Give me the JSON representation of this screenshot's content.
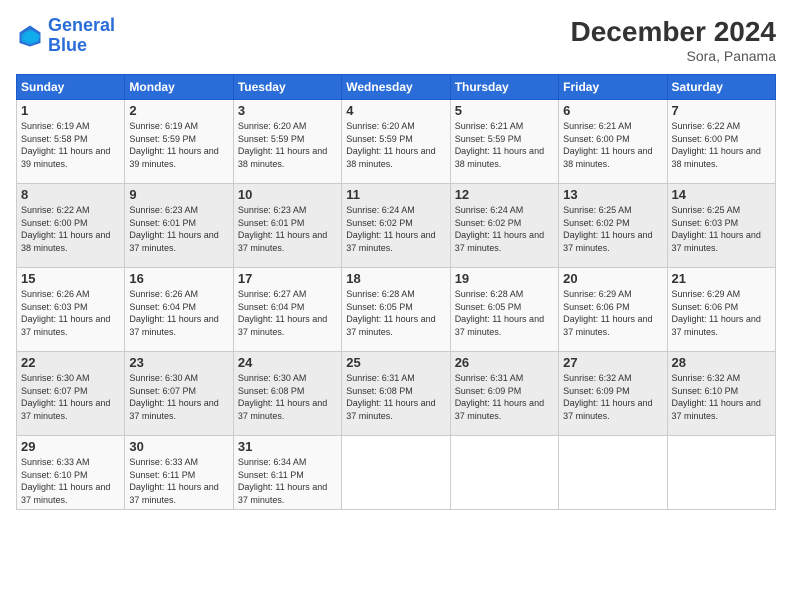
{
  "header": {
    "logo_line1": "General",
    "logo_line2": "Blue",
    "month": "December 2024",
    "location": "Sora, Panama"
  },
  "days_of_week": [
    "Sunday",
    "Monday",
    "Tuesday",
    "Wednesday",
    "Thursday",
    "Friday",
    "Saturday"
  ],
  "weeks": [
    [
      {
        "day": "1",
        "sunrise": "6:19 AM",
        "sunset": "5:58 PM",
        "daylight": "11 hours and 39 minutes."
      },
      {
        "day": "2",
        "sunrise": "6:19 AM",
        "sunset": "5:59 PM",
        "daylight": "11 hours and 39 minutes."
      },
      {
        "day": "3",
        "sunrise": "6:20 AM",
        "sunset": "5:59 PM",
        "daylight": "11 hours and 38 minutes."
      },
      {
        "day": "4",
        "sunrise": "6:20 AM",
        "sunset": "5:59 PM",
        "daylight": "11 hours and 38 minutes."
      },
      {
        "day": "5",
        "sunrise": "6:21 AM",
        "sunset": "5:59 PM",
        "daylight": "11 hours and 38 minutes."
      },
      {
        "day": "6",
        "sunrise": "6:21 AM",
        "sunset": "6:00 PM",
        "daylight": "11 hours and 38 minutes."
      },
      {
        "day": "7",
        "sunrise": "6:22 AM",
        "sunset": "6:00 PM",
        "daylight": "11 hours and 38 minutes."
      }
    ],
    [
      {
        "day": "8",
        "sunrise": "6:22 AM",
        "sunset": "6:00 PM",
        "daylight": "11 hours and 38 minutes."
      },
      {
        "day": "9",
        "sunrise": "6:23 AM",
        "sunset": "6:01 PM",
        "daylight": "11 hours and 37 minutes."
      },
      {
        "day": "10",
        "sunrise": "6:23 AM",
        "sunset": "6:01 PM",
        "daylight": "11 hours and 37 minutes."
      },
      {
        "day": "11",
        "sunrise": "6:24 AM",
        "sunset": "6:02 PM",
        "daylight": "11 hours and 37 minutes."
      },
      {
        "day": "12",
        "sunrise": "6:24 AM",
        "sunset": "6:02 PM",
        "daylight": "11 hours and 37 minutes."
      },
      {
        "day": "13",
        "sunrise": "6:25 AM",
        "sunset": "6:02 PM",
        "daylight": "11 hours and 37 minutes."
      },
      {
        "day": "14",
        "sunrise": "6:25 AM",
        "sunset": "6:03 PM",
        "daylight": "11 hours and 37 minutes."
      }
    ],
    [
      {
        "day": "15",
        "sunrise": "6:26 AM",
        "sunset": "6:03 PM",
        "daylight": "11 hours and 37 minutes."
      },
      {
        "day": "16",
        "sunrise": "6:26 AM",
        "sunset": "6:04 PM",
        "daylight": "11 hours and 37 minutes."
      },
      {
        "day": "17",
        "sunrise": "6:27 AM",
        "sunset": "6:04 PM",
        "daylight": "11 hours and 37 minutes."
      },
      {
        "day": "18",
        "sunrise": "6:28 AM",
        "sunset": "6:05 PM",
        "daylight": "11 hours and 37 minutes."
      },
      {
        "day": "19",
        "sunrise": "6:28 AM",
        "sunset": "6:05 PM",
        "daylight": "11 hours and 37 minutes."
      },
      {
        "day": "20",
        "sunrise": "6:29 AM",
        "sunset": "6:06 PM",
        "daylight": "11 hours and 37 minutes."
      },
      {
        "day": "21",
        "sunrise": "6:29 AM",
        "sunset": "6:06 PM",
        "daylight": "11 hours and 37 minutes."
      }
    ],
    [
      {
        "day": "22",
        "sunrise": "6:30 AM",
        "sunset": "6:07 PM",
        "daylight": "11 hours and 37 minutes."
      },
      {
        "day": "23",
        "sunrise": "6:30 AM",
        "sunset": "6:07 PM",
        "daylight": "11 hours and 37 minutes."
      },
      {
        "day": "24",
        "sunrise": "6:30 AM",
        "sunset": "6:08 PM",
        "daylight": "11 hours and 37 minutes."
      },
      {
        "day": "25",
        "sunrise": "6:31 AM",
        "sunset": "6:08 PM",
        "daylight": "11 hours and 37 minutes."
      },
      {
        "day": "26",
        "sunrise": "6:31 AM",
        "sunset": "6:09 PM",
        "daylight": "11 hours and 37 minutes."
      },
      {
        "day": "27",
        "sunrise": "6:32 AM",
        "sunset": "6:09 PM",
        "daylight": "11 hours and 37 minutes."
      },
      {
        "day": "28",
        "sunrise": "6:32 AM",
        "sunset": "6:10 PM",
        "daylight": "11 hours and 37 minutes."
      }
    ],
    [
      {
        "day": "29",
        "sunrise": "6:33 AM",
        "sunset": "6:10 PM",
        "daylight": "11 hours and 37 minutes."
      },
      {
        "day": "30",
        "sunrise": "6:33 AM",
        "sunset": "6:11 PM",
        "daylight": "11 hours and 37 minutes."
      },
      {
        "day": "31",
        "sunrise": "6:34 AM",
        "sunset": "6:11 PM",
        "daylight": "11 hours and 37 minutes."
      },
      {
        "day": "",
        "sunrise": "",
        "sunset": "",
        "daylight": ""
      },
      {
        "day": "",
        "sunrise": "",
        "sunset": "",
        "daylight": ""
      },
      {
        "day": "",
        "sunrise": "",
        "sunset": "",
        "daylight": ""
      },
      {
        "day": "",
        "sunrise": "",
        "sunset": "",
        "daylight": ""
      }
    ]
  ],
  "labels": {
    "sunrise": "Sunrise:",
    "sunset": "Sunset:",
    "daylight": "Daylight:"
  }
}
